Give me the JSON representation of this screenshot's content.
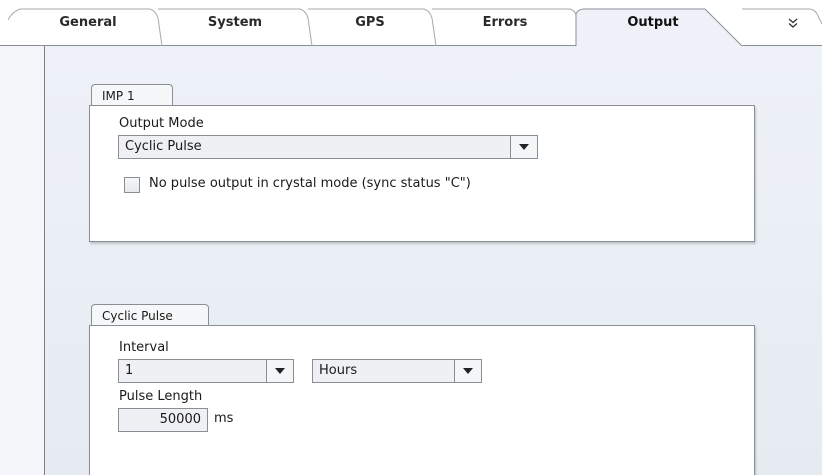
{
  "tabs": [
    {
      "label": "General",
      "active": false
    },
    {
      "label": "System",
      "active": false
    },
    {
      "label": "GPS",
      "active": false
    },
    {
      "label": "Errors",
      "active": false
    },
    {
      "label": "Output",
      "active": true
    }
  ],
  "more_icon": "double-chevron-down-icon",
  "imp_group": {
    "tab_label": "IMP 1",
    "output_mode_label": "Output Mode",
    "output_mode_value": "Cyclic Pulse",
    "crystal_checkbox_label": "No pulse output in crystal mode (sync status \"C\")",
    "crystal_checkbox_checked": false
  },
  "cyclic_group": {
    "tab_label": "Cyclic Pulse",
    "interval_label": "Interval",
    "interval_value": "1",
    "interval_unit": "Hours",
    "pulse_length_label": "Pulse Length",
    "pulse_length_value": "50000",
    "pulse_length_unit": "ms"
  },
  "colors": {
    "border": "#8a8f96",
    "content_bg": "#eef2f8",
    "panel_bg": "#ffffff"
  }
}
